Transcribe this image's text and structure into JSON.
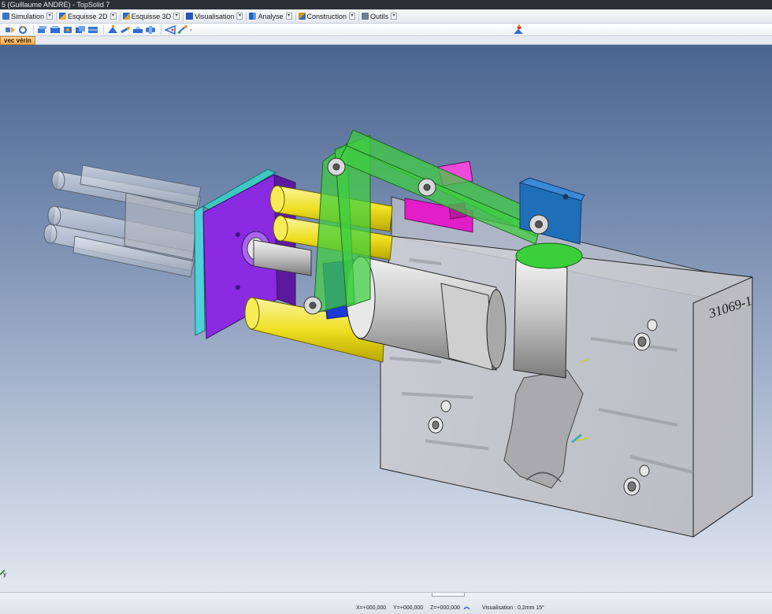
{
  "window": {
    "title": "5 (Guillaume ANDRE) - TopSolid 7"
  },
  "ribbon": {
    "tabs": [
      {
        "label": "Simulation",
        "icon": "simulation-icon",
        "color": "#3b73c7"
      },
      {
        "label": "Esquisse 2D",
        "icon": "sketch-2d-icon",
        "color": "#2f6bd1"
      },
      {
        "label": "Esquisse 3D",
        "icon": "sketch-3d-icon",
        "color": "#2f6bd1"
      },
      {
        "label": "Visualisation",
        "icon": "visualisation-icon",
        "color": "#2556b8"
      },
      {
        "label": "Analyse",
        "icon": "analyse-icon",
        "color": "#2a5fc2"
      },
      {
        "label": "Construction",
        "icon": "construction-icon",
        "color": "#c99a1a"
      },
      {
        "label": "Outils",
        "icon": "tools-icon",
        "color": "#6f7d8c"
      }
    ]
  },
  "toolbar": {
    "icons": [
      "simulation-tool-icon",
      "rotate-tool-icon",
      "part-tool-icon",
      "assembly-tool-icon",
      "feature-tool-icon",
      "duplicate-tool-icon",
      "pattern-tool-icon",
      "sketch-tool-icon",
      "pin-tool-icon",
      "constraint-tool-icon",
      "motion-tool-icon",
      "view-tool-icon",
      "measure-tool-icon",
      "dropdown-tool-icon"
    ],
    "right_icon": "orientation-icon"
  },
  "document": {
    "tab_label": "vec vérin"
  },
  "viewport": {
    "part_engraving": "31069-1",
    "axis_label": "y"
  },
  "statusbar": {
    "x": "X=+000,000",
    "y": "Y=+000,000",
    "z": "Z=+000,000",
    "visualisation": "Visualisation : 0,2mm 15°"
  },
  "colors": {
    "background_top": "#4a6591",
    "background_bottom": "#e2e7ef",
    "mold_block": "#c9c9cc",
    "violet_plate": "#8a2be2",
    "cyan_plate": "#4fd1d9",
    "yellow_rods": "#f0e226",
    "green_links": "#3fcf3f",
    "magenta_block": "#e21ec9",
    "blue_bracket": "#1f6fb8",
    "document_tab": "#f3a94a"
  }
}
